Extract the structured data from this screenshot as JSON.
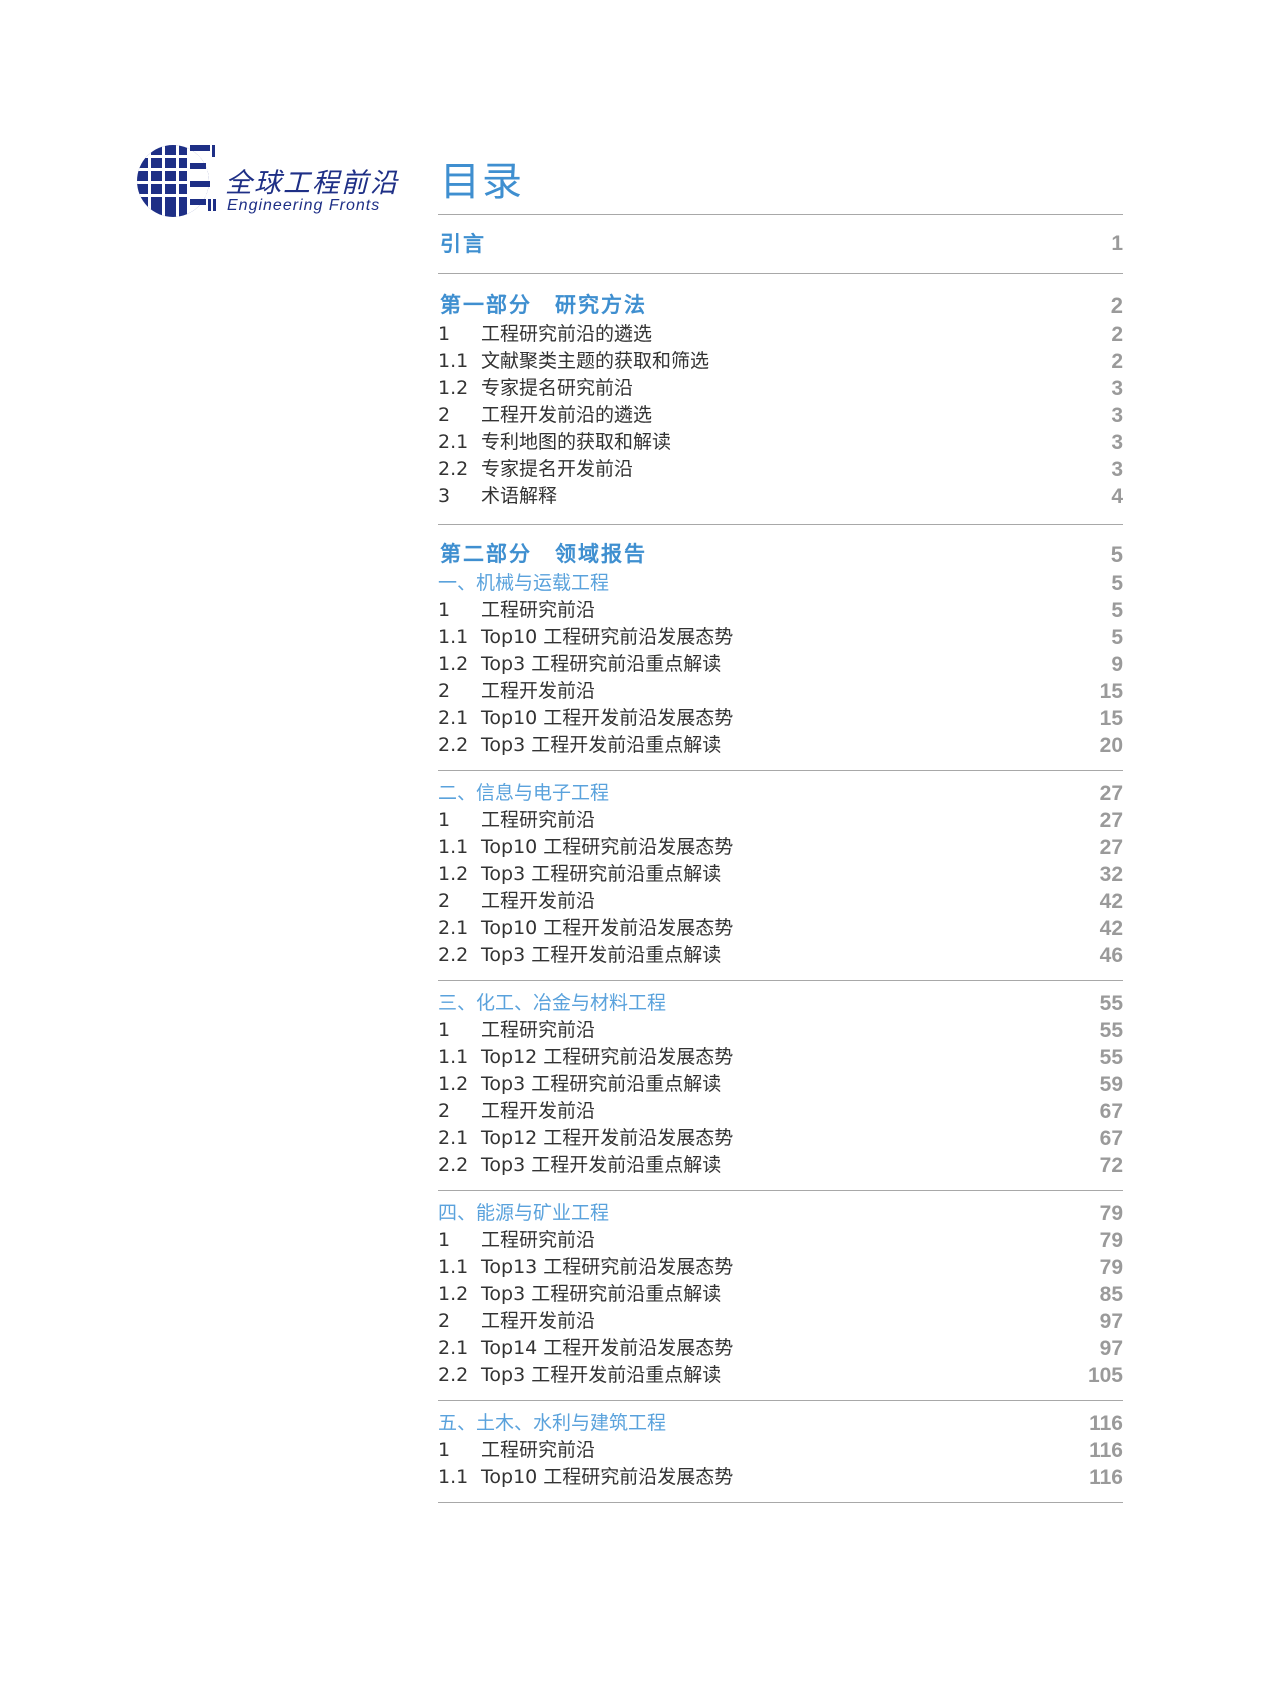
{
  "logo": {
    "name_cn": "全球工程前沿",
    "name_en": "Engineering Fronts"
  },
  "toc": {
    "title": "目录",
    "intro": {
      "title": "引言",
      "page": "1"
    },
    "part1": {
      "title": "第一部分　研究方法",
      "page": "2",
      "items": [
        {
          "num": "1",
          "text": "工程研究前沿的遴选",
          "page": "2"
        },
        {
          "num": "1.1",
          "text": "文献聚类主题的获取和筛选",
          "page": "2"
        },
        {
          "num": "1.2",
          "text": "专家提名研究前沿",
          "page": "3"
        },
        {
          "num": "2",
          "text": "工程开发前沿的遴选",
          "page": "3"
        },
        {
          "num": "2.1",
          "text": "专利地图的获取和解读",
          "page": "3"
        },
        {
          "num": "2.2",
          "text": "专家提名开发前沿",
          "page": "3"
        },
        {
          "num": "3",
          "text": "术语解释",
          "page": "4"
        }
      ]
    },
    "part2": {
      "title": "第二部分　领域报告",
      "page": "5",
      "domains": [
        {
          "title": "一、机械与运载工程",
          "page": "5",
          "items": [
            {
              "num": "1",
              "text": "工程研究前沿",
              "page": "5"
            },
            {
              "num": "1.1",
              "text": "Top10 工程研究前沿发展态势",
              "page": "5"
            },
            {
              "num": "1.2",
              "text": "Top3 工程研究前沿重点解读",
              "page": "9"
            },
            {
              "num": "2",
              "text": "工程开发前沿",
              "page": "15"
            },
            {
              "num": "2.1",
              "text": "Top10 工程开发前沿发展态势",
              "page": "15"
            },
            {
              "num": "2.2",
              "text": "Top3 工程开发前沿重点解读",
              "page": "20"
            }
          ]
        },
        {
          "title": "二、信息与电子工程",
          "page": "27",
          "items": [
            {
              "num": "1",
              "text": "工程研究前沿",
              "page": "27"
            },
            {
              "num": "1.1",
              "text": "Top10 工程研究前沿发展态势",
              "page": "27"
            },
            {
              "num": "1.2",
              "text": "Top3 工程研究前沿重点解读",
              "page": "32"
            },
            {
              "num": "2",
              "text": "工程开发前沿",
              "page": "42"
            },
            {
              "num": "2.1",
              "text": "Top10 工程开发前沿发展态势",
              "page": "42"
            },
            {
              "num": "2.2",
              "text": "Top3 工程开发前沿重点解读",
              "page": "46"
            }
          ]
        },
        {
          "title": "三、化工、冶金与材料工程",
          "page": "55",
          "items": [
            {
              "num": "1",
              "text": "工程研究前沿",
              "page": "55"
            },
            {
              "num": "1.1",
              "text": "Top12 工程研究前沿发展态势",
              "page": "55"
            },
            {
              "num": "1.2",
              "text": "Top3 工程研究前沿重点解读",
              "page": "59"
            },
            {
              "num": "2",
              "text": "工程开发前沿",
              "page": "67"
            },
            {
              "num": "2.1",
              "text": "Top12 工程开发前沿发展态势",
              "page": "67"
            },
            {
              "num": "2.2",
              "text": "Top3 工程开发前沿重点解读",
              "page": "72"
            }
          ]
        },
        {
          "title": "四、能源与矿业工程",
          "page": "79",
          "items": [
            {
              "num": "1",
              "text": "工程研究前沿",
              "page": "79"
            },
            {
              "num": "1.1",
              "text": "Top13 工程研究前沿发展态势",
              "page": "79"
            },
            {
              "num": "1.2",
              "text": "Top3 工程研究前沿重点解读",
              "page": "85"
            },
            {
              "num": "2",
              "text": "工程开发前沿",
              "page": "97"
            },
            {
              "num": "2.1",
              "text": "Top14 工程开发前沿发展态势",
              "page": "97"
            },
            {
              "num": "2.2",
              "text": "Top3 工程开发前沿重点解读",
              "page": "105"
            }
          ]
        },
        {
          "title": "五、土木、水利与建筑工程",
          "page": "116",
          "items": [
            {
              "num": "1",
              "text": "工程研究前沿",
              "page": "116"
            },
            {
              "num": "1.1",
              "text": "Top10 工程研究前沿发展态势",
              "page": "116"
            }
          ]
        }
      ]
    }
  },
  "colors": {
    "logo_blue": "#1e2f86",
    "heading_blue": "#3f8fd0",
    "domain_blue": "#5aa2dc",
    "page_gray": "#9a9a9a",
    "rule_gray": "#a8a8a8"
  }
}
